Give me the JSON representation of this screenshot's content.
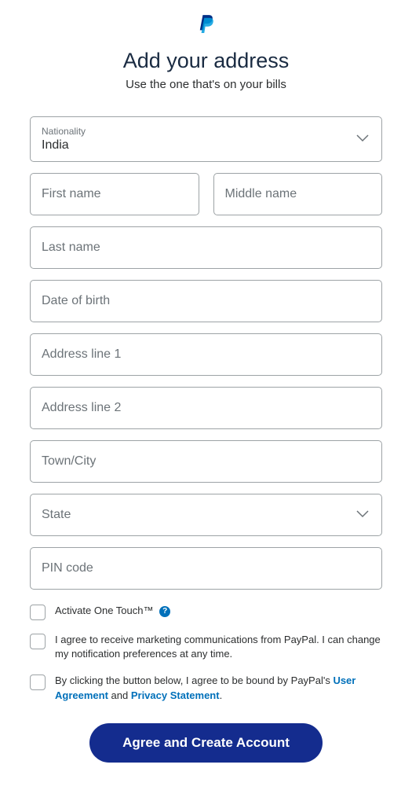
{
  "header": {
    "title": "Add your address",
    "subtitle": "Use the one that's on your bills"
  },
  "nationality": {
    "label": "Nationality",
    "value": "India"
  },
  "fields": {
    "firstName": "First name",
    "middleName": "Middle name",
    "lastName": "Last name",
    "dob": "Date of birth",
    "address1": "Address line 1",
    "address2": "Address line 2",
    "townCity": "Town/City",
    "state": "State",
    "pinCode": "PIN code"
  },
  "checkboxes": {
    "oneTouch": "Activate One Touch™",
    "marketing": "I agree to receive marketing communications from PayPal. I can change my notification preferences at any time.",
    "termsPrefix": "By clicking the button below, I agree to be bound by PayPal's ",
    "userAgreement": "User Agreement",
    "and": " and ",
    "privacyStatement": "Privacy Statement",
    "period": "."
  },
  "submitLabel": "Agree and Create Account"
}
